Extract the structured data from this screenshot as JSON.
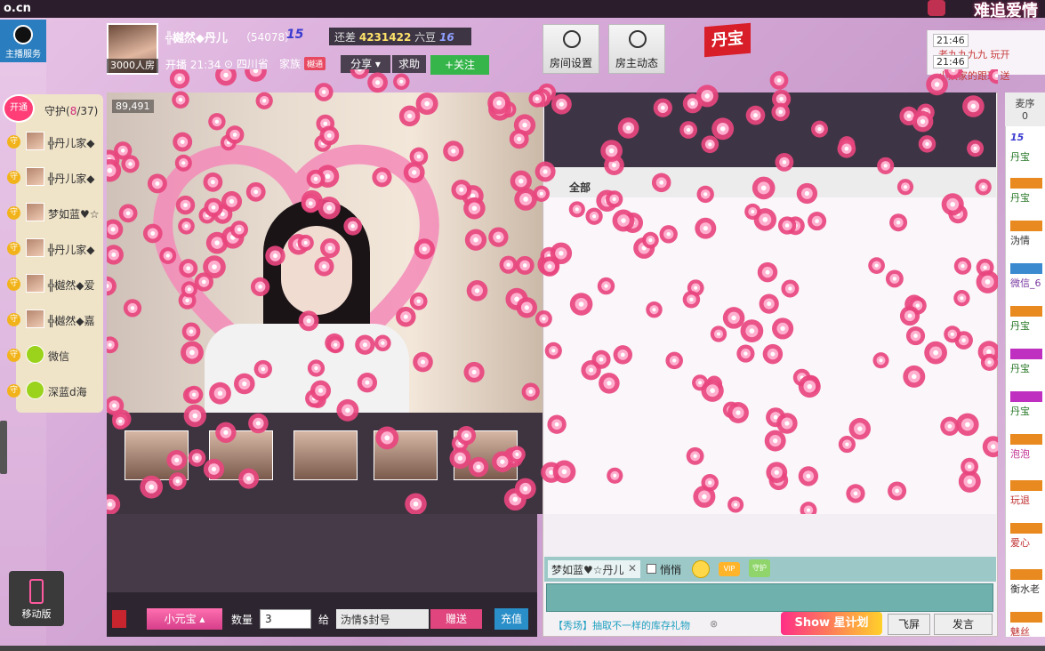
{
  "site": {
    "logo": "o.cn",
    "banner_title": "难追爱情"
  },
  "rail": {
    "service_label": "主播服务",
    "mobile_label": "移动版"
  },
  "anchor": {
    "name": "╬樾然◆丹儿",
    "id_text": "（54078）",
    "level": "15",
    "gap_prefix": "还差",
    "gap_value": "4231422",
    "gap_unit": "六豆",
    "next_level": "16",
    "room_count": "3000人房",
    "live_time": "开播 21:34",
    "region": "四川省",
    "family_label": "家族",
    "family_badge": "樾通"
  },
  "header_buttons": {
    "share": "分享",
    "help": "求助",
    "follow": "+关注"
  },
  "tools": {
    "settings": "房间设置",
    "dynamics": "房主动态"
  },
  "brand_badge": "丹宝",
  "chat_preview": [
    {
      "time": "21:46",
      "msg": "老九九九九 玩开"
    },
    {
      "time": "21:46",
      "msg": "小妖家的跟班 送"
    }
  ],
  "guard": {
    "open_label": "开通",
    "title": "守护(",
    "count": "8",
    "total": "/37)",
    "items": [
      {
        "name": "╬丹儿家◆"
      },
      {
        "name": "╬丹儿家◆"
      },
      {
        "name": "梦如蓝♥☆"
      },
      {
        "name": "╬丹儿家◆"
      },
      {
        "name": "╬樾然◆爱"
      },
      {
        "name": "╬樾然◆嘉"
      },
      {
        "name": "微信"
      },
      {
        "name": "深蓝d海"
      }
    ]
  },
  "video": {
    "viewer_count": "89,491"
  },
  "giftbar": {
    "gift_name": "小元宝",
    "qty_label": "数量",
    "qty_value": "3",
    "to_label": "给",
    "recipient": "沩情$封号",
    "send": "赠送",
    "recharge": "充值"
  },
  "chat": {
    "tab_all": "全部",
    "at_user": "梦如蓝♥☆丹儿",
    "whisper": "悄悄",
    "vip": "VIP",
    "guard_icon": "守护",
    "show_tip": "【秀场】抽取不一样的库存礼物",
    "star_plan": "Show 星计划",
    "fly": "飞屏",
    "post": "发言"
  },
  "right_list": {
    "head": "麦序",
    "head_count": "0",
    "items": [
      "15",
      "丹宝",
      "丹宝",
      "沩情",
      "微信_6",
      "丹宝",
      "丹宝",
      "丹宝",
      "泡泡",
      "玩退",
      "爱心",
      "衡水老",
      "魅丝"
    ]
  },
  "colors": {
    "accent_pink": "#ff3d77",
    "follow_green": "#35b54a",
    "recharge_blue": "#2a8fc9"
  }
}
